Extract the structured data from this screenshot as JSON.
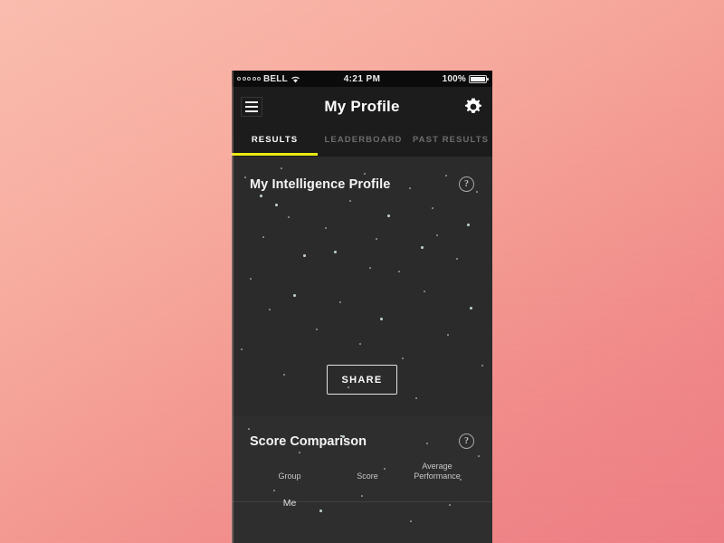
{
  "background": {
    "gradient_from": "#f9bcae",
    "gradient_to": "#ec7b82"
  },
  "status_bar": {
    "carrier": "BELL",
    "signal_icon": "signal-dots-icon",
    "wifi_icon": "wifi-icon",
    "time": "4:21 PM",
    "battery_percent": "100%",
    "battery_icon": "battery-full-icon"
  },
  "nav": {
    "menu_icon": "hamburger-menu-icon",
    "title": "My Profile",
    "settings_icon": "gear-icon"
  },
  "tabs": {
    "active_index": 0,
    "accent_color": "#eaea10",
    "items": [
      {
        "label": "RESULTS"
      },
      {
        "label": "LEADERBOARD"
      },
      {
        "label": "PAST RESULTS"
      }
    ]
  },
  "profile_card": {
    "title": "My Intelligence Profile",
    "help_icon": "question-mark-icon",
    "help_label": "?",
    "share_label": "SHARE",
    "background_color": "#2b2b2c"
  },
  "score_card": {
    "title": "Score Comparison",
    "help_icon": "question-mark-icon",
    "help_label": "?",
    "columns": [
      {
        "label": "Group"
      },
      {
        "label": "Score"
      },
      {
        "label_line1": "Average",
        "label_line2": "Performance"
      }
    ],
    "rows": [
      {
        "group": "Me",
        "score": "",
        "average": ""
      }
    ]
  }
}
